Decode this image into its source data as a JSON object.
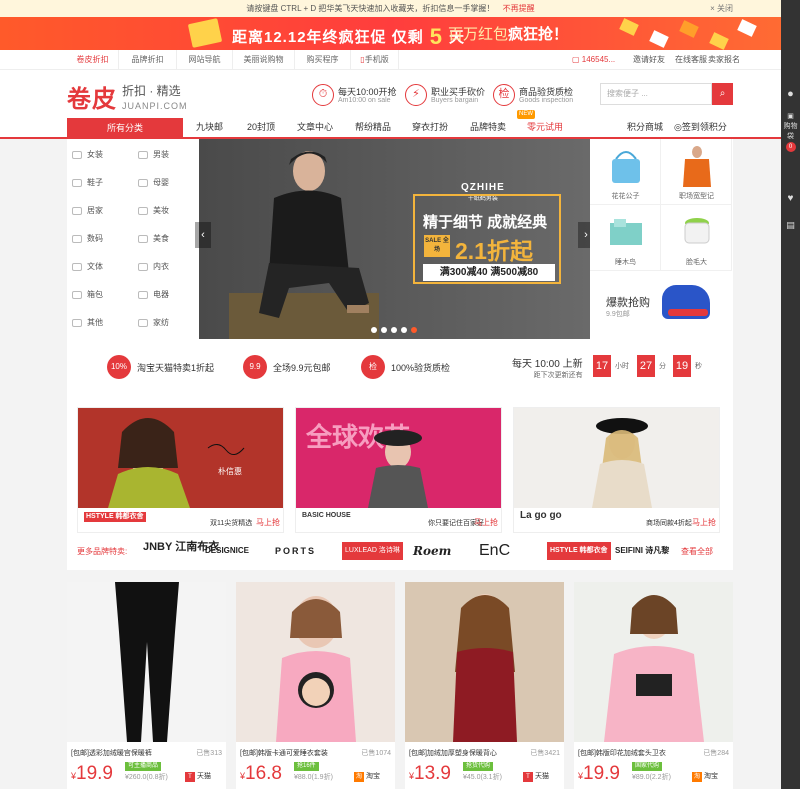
{
  "notice": {
    "text": "请按键盘 CTRL + D 把华美飞天快速加入收藏夹，折扣信息一手掌握！",
    "remind": "不再提醒",
    "close": "× 关闭"
  },
  "promo": {
    "countdown_pre": "距离12.12年终疯狂促 仅剩",
    "days": "5",
    "countdown_post": "天",
    "redbag": "百万红包",
    "redbag_hl": "疯狂抢！"
  },
  "topnav": {
    "items": [
      "卷皮折扣",
      "品牌折扣",
      "网站导航",
      "美丽说购物",
      "购买程序",
      "手机版"
    ],
    "user": "146545...",
    "invite": "邀请好友",
    "service": "在线客服",
    "seller": "卖家报名"
  },
  "header": {
    "logo": "卷皮",
    "slogan": "折扣 · 精选",
    "domain": "JUANPI.COM",
    "features": [
      {
        "icon": "⏱",
        "t1": "每天10:00开抢",
        "t2": "Am10:00 on sale"
      },
      {
        "icon": "⚡",
        "t1": "职业买手砍价",
        "t2": "Buyers bargain"
      },
      {
        "icon": "检",
        "t1": "商品验货质检",
        "t2": "Goods inspection"
      }
    ],
    "search_placeholder": "搜索便子 ...",
    "search_icon": "search-icon"
  },
  "catbar": {
    "all": "所有分类",
    "items": [
      "九块邮",
      "20封顶",
      "文章中心",
      "帮纷精品",
      "穿衣打扮",
      "品牌特卖",
      "零元试用",
      "积分商城",
      "签到领积分"
    ],
    "new_badge": "NEW"
  },
  "sidebar": {
    "cats": [
      "女装",
      "男装",
      "鞋子",
      "母婴",
      "居家",
      "美妆",
      "数码",
      "美食",
      "文体",
      "内衣",
      "箱包",
      "电器",
      "其他",
      "家纺"
    ]
  },
  "banner": {
    "brand": "QZHIHE",
    "brand_sub": "千纸鹤男装",
    "headline": "精于细节 成就经典",
    "sale": "SALE 全场",
    "discount": "2.1折起",
    "deal": "满300减40  满500减80"
  },
  "rightgrid": {
    "items": [
      "花花公子",
      "职场宽型记",
      "睡木鸟",
      "脸毛大"
    ],
    "hot_title": "爆款抢购",
    "hot_sub": "9.9包邮"
  },
  "services": {
    "items": [
      {
        "icon": "10%",
        "text": "淘宝天猫特卖1折起"
      },
      {
        "icon": "9.9",
        "text": "全场9.9元包邮"
      },
      {
        "icon": "检",
        "text": "100%验货质检"
      }
    ],
    "timer_title": "每天 10:00 上新",
    "timer_sub": "距下次更新还有",
    "h": "17",
    "h_unit": "小时",
    "m": "27",
    "m_unit": "分",
    "s": "19",
    "s_unit": "秒"
  },
  "brands": {
    "cards": [
      {
        "logo": "HSTYLE 韩都衣舍",
        "text": "双11尖货精选",
        "go": "马上抢",
        "sign": "朴信惠"
      },
      {
        "logo": "BASIC HOUSE",
        "text": "你只要记住百家好",
        "go": "马上抢",
        "banner": "全球欢节"
      },
      {
        "logo": "La go go",
        "text": "商场同款4折起",
        "go": "马上抢"
      }
    ],
    "more_label": "更多品牌特卖:",
    "logos": [
      "JNBY 江南布衣",
      "DESIGNICE",
      "PORTS",
      "LUXLEAD 洛诗琳",
      "Roem",
      "EnC",
      "HSTYLE 韩都衣舍",
      "SEIFINI 诗凡黎"
    ],
    "view_all": "查看全部"
  },
  "products": [
    {
      "title": "[包邮]透彩加绒暖宫保暖裤",
      "sold": "已售313",
      "price": "19.9",
      "tag": "可主播商品",
      "orig": "¥260.0(0.8折)",
      "shop": "天猫",
      "shop_icon": "T"
    },
    {
      "title": "[包邮]韩版卡通可爱睡衣套装",
      "sold": "已售1074",
      "price": "16.8",
      "tag": "抢16件",
      "orig": "¥88.0(1.9折)",
      "shop": "淘宝",
      "shop_icon": "淘"
    },
    {
      "title": "[包邮]加绒加厚塑身保暖背心",
      "sold": "已售3421",
      "price": "13.9",
      "tag": "抢货代购",
      "orig": "¥45.0(3.1折)",
      "shop": "天猫",
      "shop_icon": "T"
    },
    {
      "title": "[包邮]韩版印花加绒套头卫衣",
      "sold": "已售284",
      "price": "19.9",
      "tag": "国家代购",
      "orig": "¥89.0(2.2折)",
      "shop": "淘宝",
      "shop_icon": "淘"
    }
  ],
  "dock": {
    "user_icon": "user-icon",
    "cart": "购物袋",
    "cart_count": "0",
    "heart_icon": "heart-icon",
    "gift_icon": "gift-icon"
  }
}
